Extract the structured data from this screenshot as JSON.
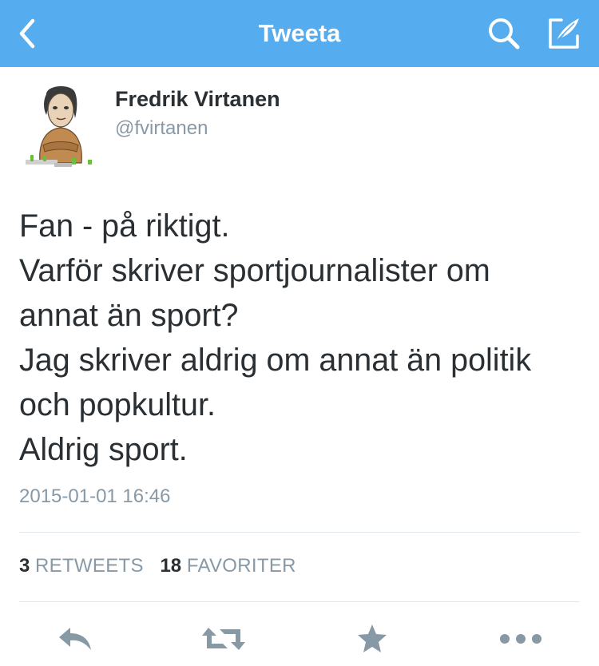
{
  "nav": {
    "title": "Tweeta",
    "back_icon": "chevron-left-icon",
    "search_icon": "search-icon",
    "compose_icon": "compose-tweet-icon",
    "background_color": "#55acee"
  },
  "tweet": {
    "author": {
      "name": "Fredrik Virtanen",
      "handle": "@fvirtanen",
      "avatar_icon": "caricature-avatar"
    },
    "text_lines": [
      "Fan - på riktigt.",
      "Varför skriver sportjournalister om",
      "annat än sport?",
      "Jag skriver aldrig om annat än politik",
      "och popkultur.",
      "Aldrig sport."
    ],
    "timestamp": "2015-01-01 16:46",
    "stats": {
      "retweets_count": "3",
      "retweets_label": "RETWEETS",
      "favorites_count": "18",
      "favorites_label": "FAVORITER"
    }
  },
  "actions": [
    {
      "name": "reply",
      "icon": "reply-icon"
    },
    {
      "name": "retweet",
      "icon": "retweet-icon"
    },
    {
      "name": "favorite",
      "icon": "star-icon"
    },
    {
      "name": "more",
      "icon": "more-dots-icon"
    }
  ],
  "colors": {
    "text_primary": "#292f33",
    "text_secondary": "#8899a6",
    "icon_gray": "#8899a6",
    "divider": "#e1e8ed"
  }
}
